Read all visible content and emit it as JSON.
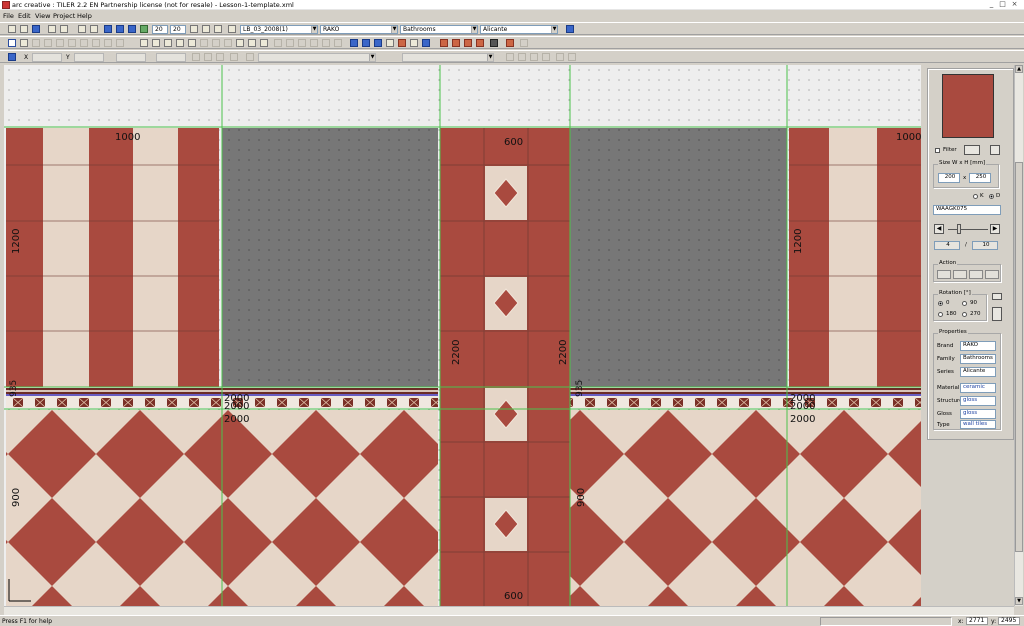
{
  "window": {
    "title": "arc creative : TILER 2.2 EN Partnership license (not for resale) - Lesson-1-template.xml",
    "controls": [
      "_",
      "□",
      "×"
    ]
  },
  "menu": [
    "File",
    "Edit",
    "View",
    "Project",
    "Help"
  ],
  "toolbar": {
    "zoom_a": "20",
    "zoom_b": "20",
    "layout_combo": "LB_03_2008(1)",
    "brand_combo": "RAKO",
    "family_combo": "Bathrooms",
    "series_combo": "Alicante"
  },
  "coords": {
    "x_label": "X",
    "y_label": "Y"
  },
  "panel": {
    "filter_label": "Filter",
    "size_title": "Size W x H [mm]",
    "width": "200",
    "x_sep": "x",
    "height": "250",
    "k_label": "K",
    "d_label": "D",
    "tile_code": "WAAGK075",
    "count_current": "4",
    "count_sep": "/",
    "count_total": "10",
    "action_title": "Action",
    "rotation_title": "Rotation [°]",
    "rot_0": "0",
    "rot_90": "90",
    "rot_180": "180",
    "rot_270": "270",
    "properties_title": "Properties",
    "properties": [
      {
        "label": "Brand",
        "value": "RAKO"
      },
      {
        "label": "Family",
        "value": "Bathrooms"
      },
      {
        "label": "Series",
        "value": "Alicante"
      },
      {
        "label": "Material",
        "value": "ceramic"
      },
      {
        "label": "Structure",
        "value": "gloss"
      },
      {
        "label": "Gloss",
        "value": "gloss"
      },
      {
        "label": "Type",
        "value": "wall tiles"
      }
    ]
  },
  "canvas": {
    "dimensions": {
      "d1000_a": "1000",
      "d1000_b": "1000",
      "d600_top": "600",
      "d600_bottom": "600",
      "d1200_a": "1200",
      "d1200_b": "1200",
      "d2200_a": "2200",
      "d2200_b": "2200",
      "d2000_a": "2000",
      "d2000_b": "2000",
      "d2000_c": "2000",
      "d2000_d": "2000",
      "d2000_e": "2000",
      "d2000_f": "2000",
      "d900_a": "900",
      "d900_b": "900",
      "d935_a": "935",
      "d935_b": "935"
    }
  },
  "status": {
    "help": "Press F1 for help",
    "x_label": "x:",
    "x_value": "2771",
    "y_label": "y:",
    "y_value": "2495"
  },
  "colors": {
    "red_tile": "#a94a3f",
    "cream_tile": "#e6d6c8",
    "wall_gray": "#777777",
    "guide_green": "#4cc14c",
    "border_blue": "#3b2fb8"
  }
}
